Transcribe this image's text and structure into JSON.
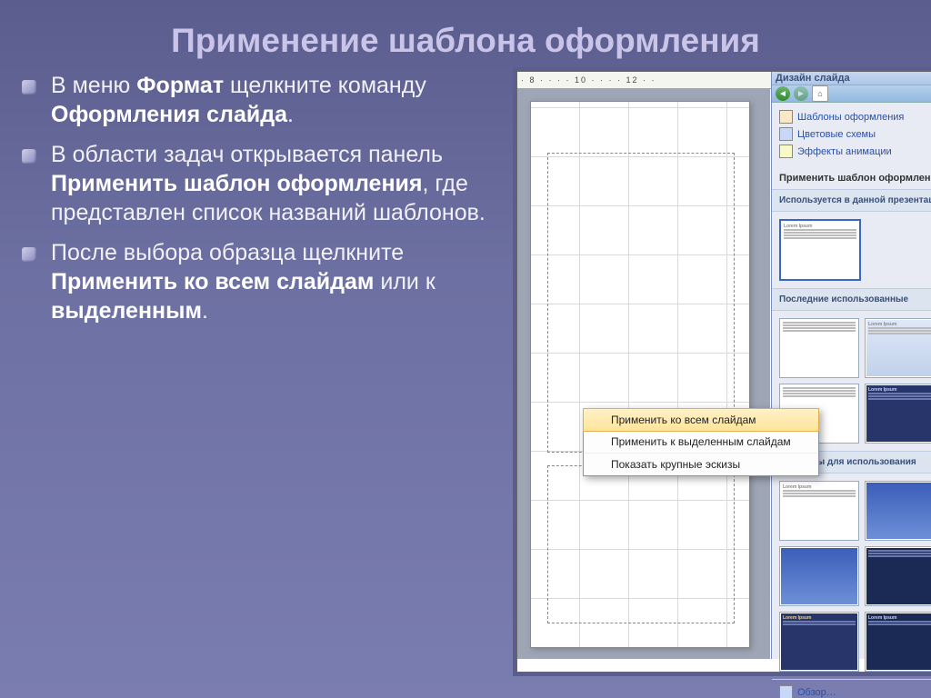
{
  "title": "Применение шаблона оформления",
  "bullets": [
    {
      "pre": "В меню ",
      "b1": "Формат",
      "mid": " щелкните команду ",
      "b2": "Оформления слайда",
      "post": "."
    },
    {
      "pre": "В области задач открывается панель ",
      "b1": "Применить шаблон оформления",
      "mid": ", где представлен список названий шаблонов.",
      "b2": "",
      "post": ""
    },
    {
      "pre": "После выбора образца щелкните ",
      "b1": "Применить ко всем слайдам",
      "mid": " или к ",
      "b2": "выделенным",
      "post": "."
    }
  ],
  "ruler": "· 8 · · · · 10 · · · · 12 · ·",
  "taskpane": {
    "title": "Дизайн слайда",
    "close_glyph": "×",
    "dropdown_glyph": "▾",
    "nav": {
      "back": "◄",
      "fwd": "►",
      "home": "⌂"
    },
    "links": [
      {
        "icon": "template-icon",
        "label": "Шаблоны оформления"
      },
      {
        "icon": "color-icon",
        "label": "Цветовые схемы"
      },
      {
        "icon": "anim-icon",
        "label": "Эффекты анимации"
      }
    ],
    "apply_header": "Применить шаблон оформления:",
    "sections": {
      "current": "Используется в данной презентации",
      "recent": "Последние использованные",
      "available": "Доступны для использования"
    },
    "browse": "Обзор…"
  },
  "context_menu": [
    "Применить ко всем слайдам",
    "Применить к выделенным слайдам",
    "Показать крупные эскизы"
  ],
  "thumb_title": "Lorem Ipsum"
}
